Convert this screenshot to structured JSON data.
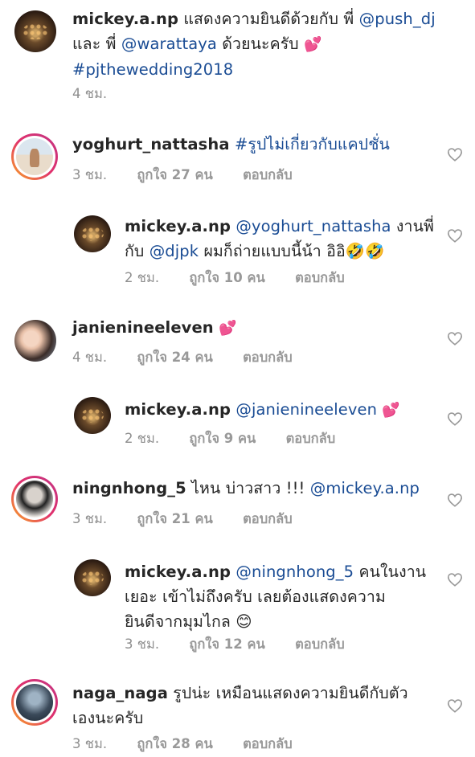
{
  "comments": [
    {
      "user": "mickey.a.np",
      "text_1": "แสดงความยินดีด้วยกับ พี่ ",
      "mention_1": "@push_dj",
      "text_2": "และ พี่ ",
      "mention_2": "@warattaya",
      "text_3": " ด้วยนะครับ ",
      "emoji": "💕",
      "hashtag": "#pjthewedding2018",
      "time": "4 ชม."
    },
    {
      "user": "yoghurt_nattasha",
      "hashtag": "#รูปไม่เกี่ยวกับแคปชั่น",
      "time": "3 ชม.",
      "likes": "ถูกใจ 27 คน",
      "reply": "ตอบกลับ"
    },
    {
      "user": "mickey.a.np",
      "mention_1": "@yoghurt_nattasha",
      "text_1": " งานพี่",
      "text_2": "กับ ",
      "mention_2": "@djpk",
      "text_3": " ผมก็ถ่ายแบบนี้น้า อิอิ",
      "emoji": "🤣🤣",
      "time": "2 ชม.",
      "likes": "ถูกใจ 10 คน",
      "reply": "ตอบกลับ"
    },
    {
      "user": "janienineeleven",
      "emoji": "💕",
      "time": "4 ชม.",
      "likes": "ถูกใจ 24 คน",
      "reply": "ตอบกลับ"
    },
    {
      "user": "mickey.a.np",
      "mention_1": "@janienineeleven",
      "emoji": "💕",
      "time": "2 ชม.",
      "likes": "ถูกใจ 9 คน",
      "reply": "ตอบกลับ"
    },
    {
      "user": "ningnhong_5",
      "text_1": " ไหน บ่าวสาว !!! ",
      "mention_1": "@mickey.a.np",
      "time": "3 ชม.",
      "likes": "ถูกใจ 21 คน",
      "reply": "ตอบกลับ"
    },
    {
      "user": "mickey.a.np",
      "mention_1": "@ningnhong_5",
      "text_1": " คนในงาน",
      "text_2": "เยอะ เข้าไม่ถึงครับ เลยต้องแสดงความ",
      "text_3": "ยินดีจากมุมไกล ",
      "emoji": "😊",
      "time": "3 ชม.",
      "likes": "ถูกใจ 12 คน",
      "reply": "ตอบกลับ"
    },
    {
      "user": "naga_naga",
      "text_1": " รูปน่ะ เหมือนแสดงความยินดีกับตัว",
      "text_2": "เองนะครับ",
      "time": "3 ชม.",
      "likes": "ถูกใจ 28 คน",
      "reply": "ตอบกลับ"
    }
  ],
  "colors": {
    "mention": "#1a4c94",
    "meta": "#8e8e8e",
    "ring": "#e1306c"
  },
  "icons": {
    "like": "heart-outline-icon"
  }
}
